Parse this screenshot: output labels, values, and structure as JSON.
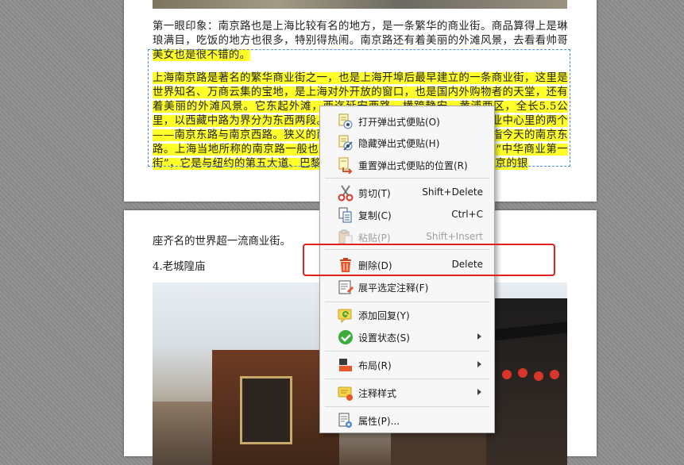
{
  "document": {
    "page1": {
      "para1_text": "第一眼印象：南京路也是上海比较有名的地方，是一条繁华的商业街。商品算得上是琳琅满目，吃饭的地方也很多，特别得热闹。南京路还有着美丽的外滩风景，去看看帅哥",
      "para1_highlight": "美女也是很不错的。",
      "para2_text": "上海南京路是著名的繁华商业街之一，也是上海开埠后最早建立的一条商业街，这里是世界知名、万商云集的宝地，是上海对外开放的窗口，也是国内外购物者的天堂，还有着美丽的外滩风景。它东起外滩，西迄延安西路，横跨静安、黄浦两区，全长5.5公里，以西藏中路为界分为东西两段。南京路是上海开埠后最早建立的商业中心里的两个——南京东路与南京西路。狭义的南京路一般仅指南京东路，南京路已指今天的南京东路。上海当地所称的南京路一般也是特指南京东路，南京路已经被誉为“中华商业第一街”，它是与纽约的第五大道、巴黎的香榭丽舍大街、伦敦的牛津街、东京的银"
    },
    "page2": {
      "line1": "座齐名的世界超一流商业街。",
      "line2": "4.老城隍庙"
    }
  },
  "context_menu": {
    "items": [
      {
        "label": "打开弹出式便贴(O)",
        "shortcut": "",
        "icon": "note-open-icon"
      },
      {
        "label": "隐藏弹出式便贴(H)",
        "shortcut": "",
        "icon": "note-hide-icon"
      },
      {
        "label": "重置弹出式便贴的位置(R)",
        "shortcut": "",
        "icon": "note-reset-icon"
      },
      {
        "label": "剪切(T)",
        "shortcut": "Shift+Delete",
        "icon": "scissors-icon"
      },
      {
        "label": "复制(C)",
        "shortcut": "Ctrl+C",
        "icon": "copy-icon"
      },
      {
        "label": "粘贴(P)",
        "shortcut": "Shift+Insert",
        "icon": "paste-icon",
        "disabled": true
      },
      {
        "label": "删除(D)",
        "shortcut": "Delete",
        "icon": "trash-icon"
      },
      {
        "label": "展平选定注释(F)",
        "shortcut": "",
        "icon": "flatten-icon"
      },
      {
        "label": "添加回复(Y)",
        "shortcut": "",
        "icon": "reply-icon"
      },
      {
        "label": "设置状态(S)",
        "shortcut": "",
        "icon": "status-check-icon",
        "submenu": true
      },
      {
        "label": "布局(R)",
        "shortcut": "",
        "icon": "layout-icon",
        "submenu": true
      },
      {
        "label": "注释样式",
        "shortcut": "",
        "icon": "style-icon",
        "submenu": true
      },
      {
        "label": "属性(P)...",
        "shortcut": "",
        "icon": "properties-icon"
      }
    ]
  },
  "colors": {
    "highlight": "#ffff2a",
    "selection_border": "#4e8de6",
    "emphasis_box": "#e02020",
    "delete_icon": "#e8562a",
    "status_icon": "#3bab3b"
  }
}
